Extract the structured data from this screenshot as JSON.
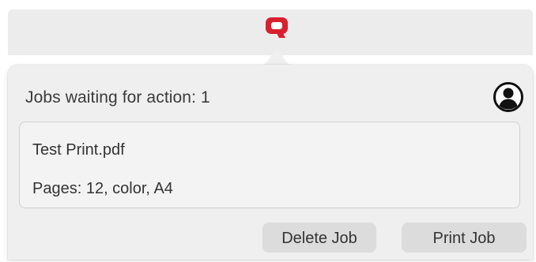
{
  "menubar": {
    "app_icon": "q-logo-icon",
    "accent_color": "#d8202e"
  },
  "popover": {
    "header": {
      "text": "Jobs waiting for action: 1",
      "account_icon": "user-account-icon"
    },
    "job": {
      "name": "Test Print.pdf",
      "details": "Pages: 12, color, A4"
    },
    "actions": {
      "delete_label": "Delete Job",
      "print_label": "Print Job"
    }
  }
}
